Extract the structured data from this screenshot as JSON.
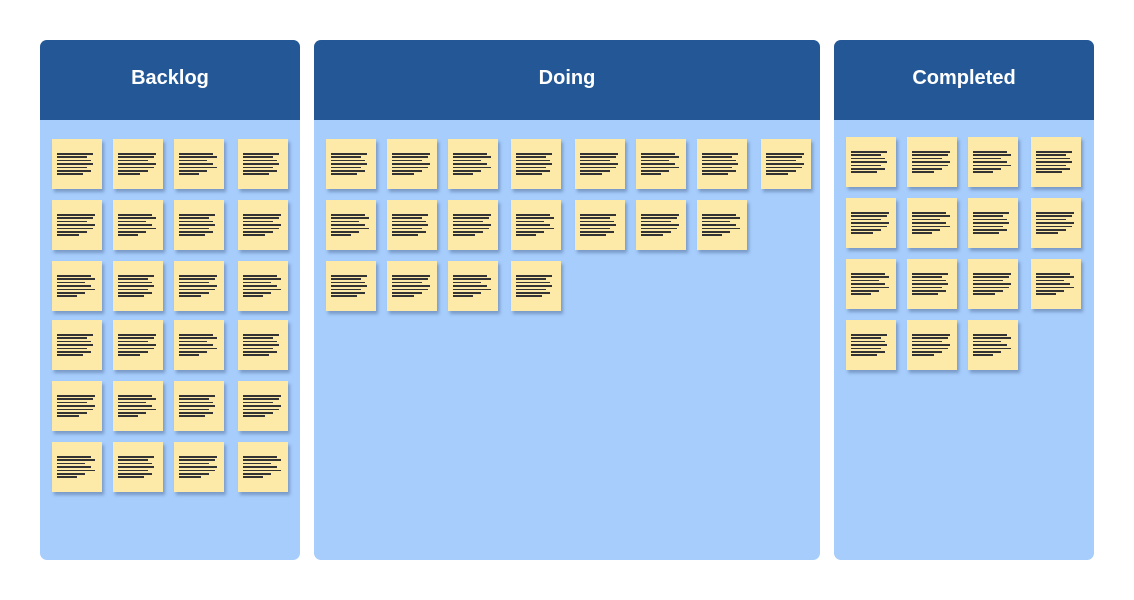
{
  "board": {
    "colors": {
      "header": "#235795",
      "column": "#a6cdfc",
      "card": "#fdeaa8"
    },
    "columns": [
      {
        "title": "Backlog",
        "card_count": 24
      },
      {
        "title": "Doing",
        "card_count": 19
      },
      {
        "title": "Completed",
        "card_count": 15
      }
    ]
  }
}
